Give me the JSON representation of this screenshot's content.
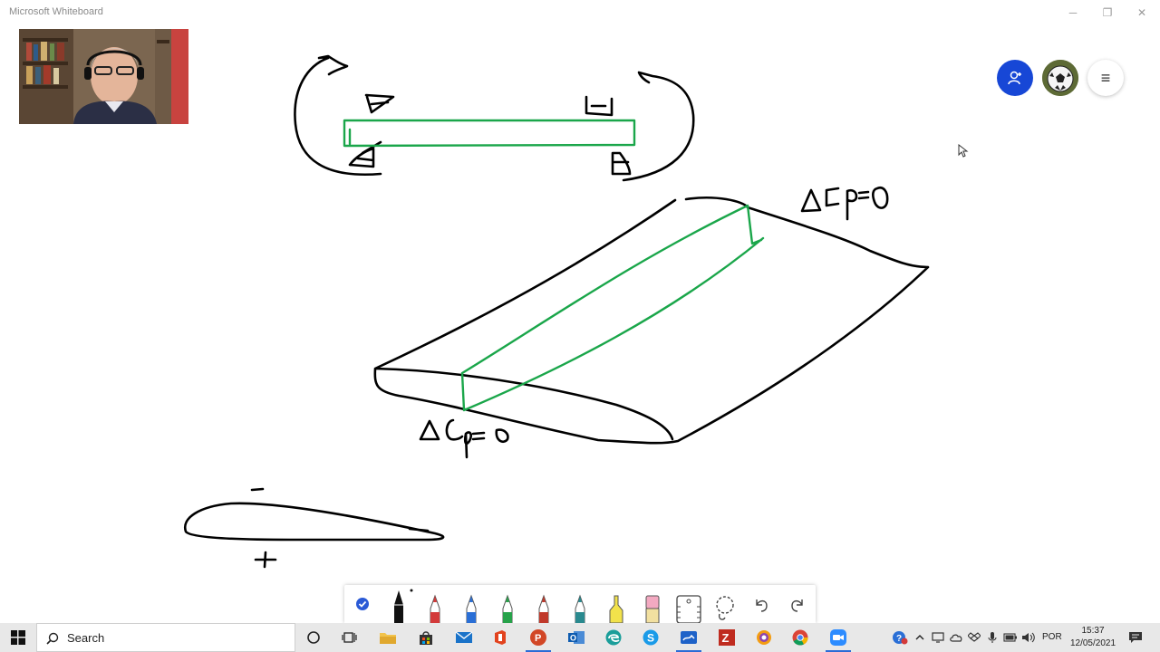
{
  "window": {
    "title": "Microsoft Whiteboard",
    "minimize_glyph": "─",
    "restore_glyph": "❐",
    "close_glyph": "✕"
  },
  "top_buttons": {
    "invite_icon": "person-add-icon",
    "avatar_icon": "soccer-ball-avatar",
    "menu_glyph": "≡"
  },
  "canvas": {
    "ink_black": "#000000",
    "ink_green": "#1aa64a",
    "labels": {
      "right_label": "ΔCp=0",
      "left_label": "ΔCp=0",
      "minus": "-",
      "plus": "+"
    }
  },
  "toolbar": {
    "tools": [
      {
        "name": "select-check",
        "icon": "check-icon"
      },
      {
        "name": "pen-black",
        "color": "#111111"
      },
      {
        "name": "pen-red",
        "color": "#d33a3a"
      },
      {
        "name": "pen-blue",
        "color": "#2a6fd6"
      },
      {
        "name": "pen-green",
        "color": "#27a24a"
      },
      {
        "name": "pen-darkred",
        "color": "#c0392b"
      },
      {
        "name": "pen-teal",
        "color": "#2a8a8f"
      },
      {
        "name": "highlighter-yellow",
        "color": "#f2e24b"
      },
      {
        "name": "eraser",
        "color": "#f3a9c1"
      },
      {
        "name": "ruler",
        "icon": "ruler-icon"
      },
      {
        "name": "lasso",
        "icon": "lasso-icon"
      },
      {
        "name": "undo",
        "icon": "undo-icon"
      },
      {
        "name": "redo",
        "icon": "redo-icon"
      }
    ]
  },
  "taskbar": {
    "search_label": "Search",
    "language": "POR",
    "time": "15:37",
    "date": "12/05/2021"
  }
}
